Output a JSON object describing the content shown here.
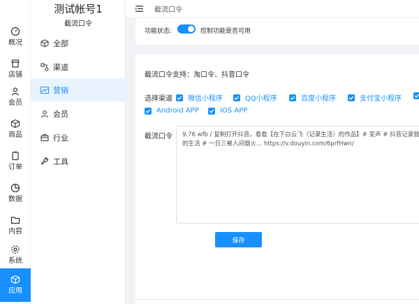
{
  "nav": {
    "items": [
      {
        "label": "概况",
        "icon": "dashboard-icon",
        "active": false
      },
      {
        "label": "店铺",
        "icon": "store-icon",
        "active": false
      },
      {
        "label": "会员",
        "icon": "member-icon",
        "active": false
      },
      {
        "label": "商品",
        "icon": "box-icon",
        "active": false
      },
      {
        "label": "订单",
        "icon": "order-icon",
        "active": false
      },
      {
        "label": "数据",
        "icon": "pie-chart-icon",
        "active": false
      },
      {
        "label": "内容",
        "icon": "folder-icon",
        "active": false
      },
      {
        "label": "系统",
        "icon": "settings-icon",
        "active": false
      },
      {
        "label": "应用",
        "icon": "app-icon",
        "active": true
      }
    ]
  },
  "sidebar": {
    "title": "测试帐号1",
    "subtitle": "截流口令",
    "items": [
      {
        "label": "全部",
        "icon": "cube-icon",
        "active": false
      },
      {
        "label": "渠道",
        "icon": "channel-icon",
        "active": false
      },
      {
        "label": "营销",
        "icon": "trend-chart-icon",
        "active": true
      },
      {
        "label": "会员",
        "icon": "user-icon",
        "active": false
      },
      {
        "label": "行业",
        "icon": "briefcase-icon",
        "active": false
      },
      {
        "label": "工具",
        "icon": "wrench-icon",
        "active": false
      }
    ]
  },
  "topbar": {
    "menu_icon": "menu-fold-icon",
    "breadcrumb": "截流口令"
  },
  "status": {
    "label": "功能状态:",
    "enabled": true,
    "description": "控制功能是否可用"
  },
  "form": {
    "support_text": "截流口令支持：淘口令、抖音口令",
    "channel_label": "选择渠道",
    "channels": [
      {
        "label": "微信小程序",
        "checked": true
      },
      {
        "label": "QQ小程序",
        "checked": true
      },
      {
        "label": "百度小程序",
        "checked": true
      },
      {
        "label": "支付宝小程序",
        "checked": true
      },
      {
        "label": "",
        "checked": true
      },
      {
        "label": "Android APP",
        "checked": true
      },
      {
        "label": "IOS APP",
        "checked": true
      }
    ],
    "command_label": "截流口令",
    "command_value": "9.76 wfb / 复制打开抖音，看看【在下白云飞（记录生活）的作品】# 变声 # 抖音记录我的生活 # 一日三餐人间烟火... https://v.douyin.com/6prfHwn/",
    "save_label": "保存"
  },
  "colors": {
    "primary": "#1890ff",
    "background": "#f0f2f5"
  }
}
